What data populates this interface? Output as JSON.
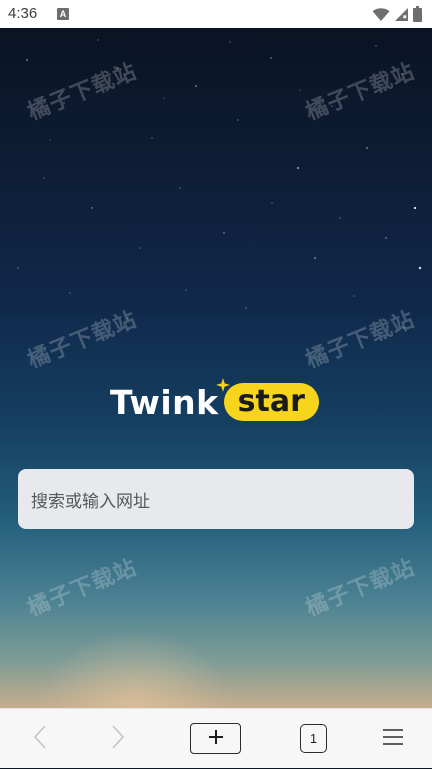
{
  "status_bar": {
    "time": "4:36",
    "notification_badge": "A",
    "icons": [
      "wifi-icon",
      "signal-icon",
      "battery-icon"
    ]
  },
  "watermark": {
    "text": "橘子下载站"
  },
  "logo": {
    "word1": "Twink",
    "word2": "star",
    "accent_color": "#f7d51c"
  },
  "search": {
    "placeholder": "搜索或输入网址"
  },
  "toolbar": {
    "back_icon": "chevron-left-icon",
    "forward_icon": "chevron-right-icon",
    "new_tab_icon": "plus-icon",
    "tab_count": "1",
    "menu_icon": "hamburger-menu-icon"
  }
}
